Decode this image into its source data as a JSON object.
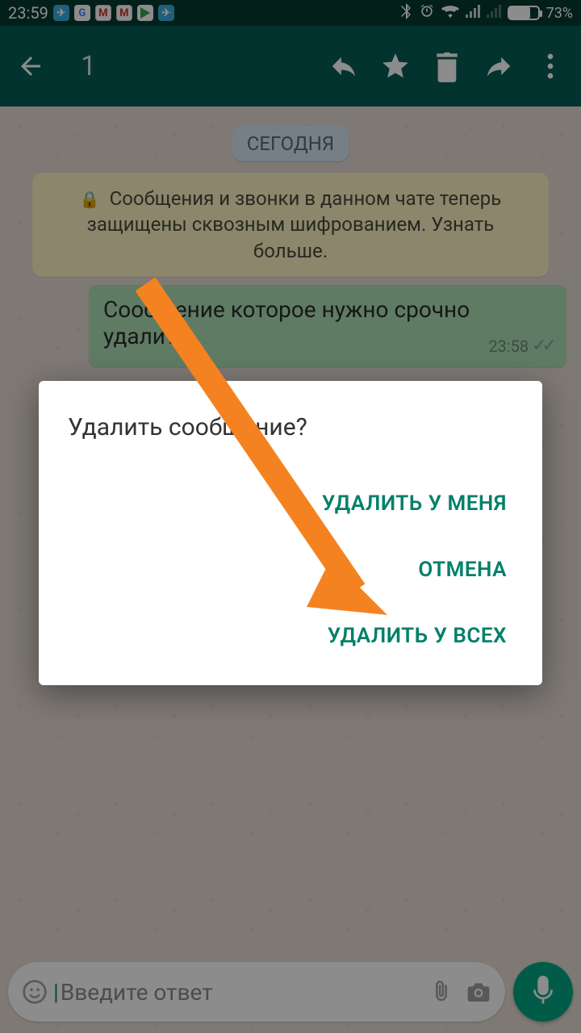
{
  "statusbar": {
    "time": "23:59",
    "battery_pct": "73%"
  },
  "actionbar": {
    "selected_count": "1"
  },
  "chat": {
    "date_chip": "СЕГОДНЯ",
    "encryption_notice": "Сообщения и звонки в данном чате теперь защищены сквозным шифрованием. Узнать больше.",
    "message_text": "Сообщение которое нужно срочно удалить",
    "message_time": "23:58"
  },
  "input": {
    "placeholder": "Введите ответ"
  },
  "dialog": {
    "title": "Удалить сообщение?",
    "delete_for_me": "УДАЛИТЬ У МЕНЯ",
    "cancel": "ОТМЕНА",
    "delete_for_all": "УДАЛИТЬ У ВСЕХ"
  }
}
